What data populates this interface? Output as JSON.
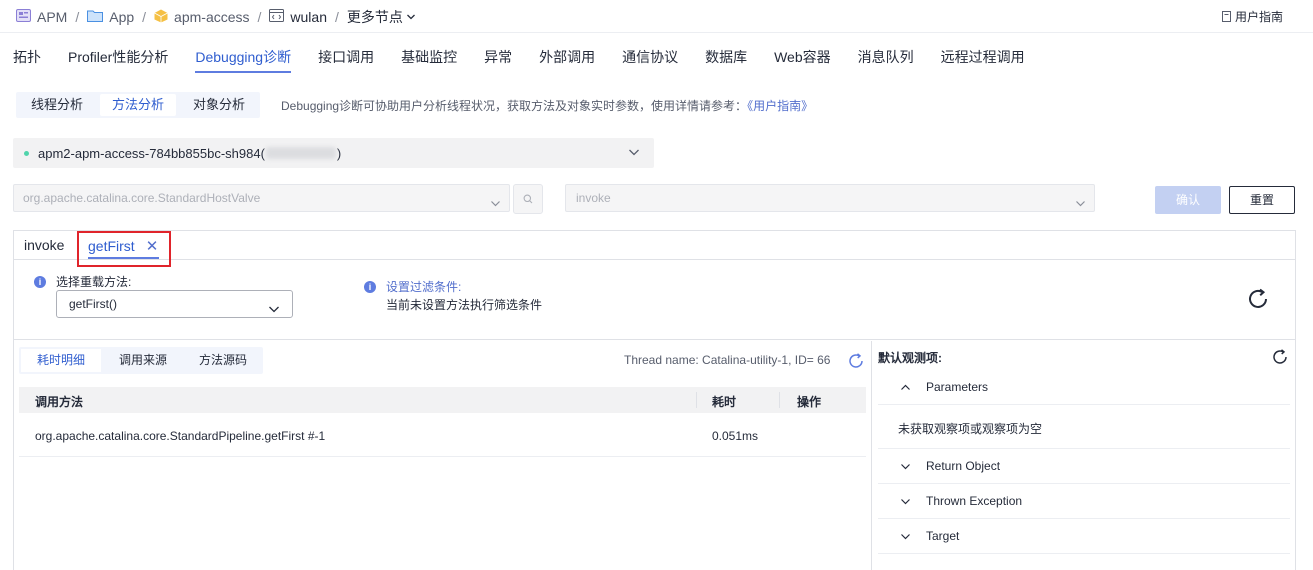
{
  "breadcrumb": {
    "items": [
      "APM",
      "App",
      "apm-access",
      "wulan"
    ],
    "separator": "/",
    "more_label": "更多节点"
  },
  "header": {
    "guide_label": "用户指南"
  },
  "main_tabs": [
    "拓扑",
    "Profiler性能分析",
    "Debugging诊断",
    "接口调用",
    "基础监控",
    "异常",
    "外部调用",
    "通信协议",
    "数据库",
    "Web容器",
    "消息队列",
    "远程过程调用"
  ],
  "main_tab_active": "Debugging诊断",
  "sub_tabs": [
    "线程分析",
    "方法分析",
    "对象分析"
  ],
  "sub_tab_active": "方法分析",
  "hint": {
    "text": "Debugging诊断可协助用户分析线程状况，获取方法及对象实时参数，使用详情请参考：",
    "link": "《用户指南》"
  },
  "pod": {
    "prefix": "apm2-apm-access-784bb855bc-sh984",
    "open_paren": "(",
    "close_paren": ")"
  },
  "class_select": {
    "value": "org.apache.catalina.core.StandardHostValve"
  },
  "method_select": {
    "value": "invoke"
  },
  "buttons": {
    "confirm": "确认",
    "reset": "重置"
  },
  "method_tabs": {
    "inactive": "invoke",
    "active": "getFirst",
    "close": "✕"
  },
  "options": {
    "overload_label": "选择重载方法:",
    "overload_value": "getFirst()",
    "filter_label": "设置过滤条件:",
    "filter_desc": "当前未设置方法执行筛选条件"
  },
  "trace_tabs": [
    "耗时明细",
    "调用来源",
    "方法源码"
  ],
  "trace_tab_active": "耗时明细",
  "thread_info": "Thread name: Catalina-utility-1, ID= 66",
  "table": {
    "headers": [
      "调用方法",
      "耗时",
      "操作"
    ],
    "rows": [
      {
        "method": "org.apache.catalina.core.StandardPipeline.getFirst #-1",
        "time": "0.051ms",
        "action": ""
      }
    ]
  },
  "observe": {
    "title": "默认观测项:",
    "sections": [
      "Parameters",
      "Return Object",
      "Thrown Exception",
      "Target"
    ],
    "empty_text": "未获取观察项或观察项为空"
  },
  "colors": {
    "accent": "#5e7ce0",
    "link": "#526ecc",
    "highlight_box": "#e0242b",
    "status_dot": "#50d4ab"
  }
}
